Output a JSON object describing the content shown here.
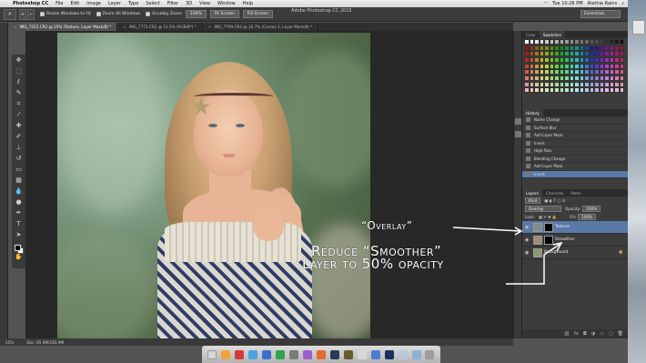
{
  "menubar": {
    "app_name": "Photoshop CC",
    "items": [
      "File",
      "Edit",
      "Image",
      "Layer",
      "Type",
      "Select",
      "Filter",
      "3D",
      "View",
      "Window",
      "Help"
    ],
    "clock": "Tue 10:26 PM",
    "user": "Alethia Rains"
  },
  "options_bar": {
    "checks": [
      "Resize Windows to Fit",
      "Zoom All Windows",
      "Scrubby Zoom"
    ],
    "buttons": [
      "100%",
      "Fit Screen",
      "Fill Screen"
    ],
    "window_title": "Adobe Photoshop CC 2015",
    "workspace": "Essentials"
  },
  "doc_tabs": [
    {
      "label": "IMG_7222.CR2 @ 25% (Texture, Layer Mask/8) *",
      "active": true
    },
    {
      "label": "IMG_7773.CR2 @ 12.5% (RGB/8*) *",
      "active": false
    },
    {
      "label": "IMG_7799.CR2 @ 16.7% (Curves 1, Layer Mask/8) *",
      "active": false
    }
  ],
  "status_bar": {
    "zoom": "25%",
    "doc": "Doc: 85.9M/185.9M"
  },
  "panels": {
    "tabs": [
      "Color",
      "Swatches"
    ],
    "history_title": "History",
    "history_items": [
      "Name Change",
      "Surface Blur",
      "Add Layer Mask",
      "Invert",
      "High Pass",
      "Blending Change",
      "Add Layer Mask",
      "Invert"
    ],
    "layers_tabs": [
      "Layers",
      "Channels",
      "Paths"
    ],
    "kind": "Kind",
    "blend_mode": "Overlay",
    "opacity_label": "Opacity:",
    "opacity_value": "100%",
    "lock_label": "Lock:",
    "fill_label": "Fill:",
    "fill_value": "100%",
    "layers": [
      {
        "name": "Texture",
        "selected": true
      },
      {
        "name": "Smoother",
        "selected": false
      },
      {
        "name": "Background",
        "selected": false
      }
    ]
  },
  "annotations": {
    "overlay": "“Overlay”",
    "line1": "Reduce “Smoother”",
    "line2": "Layer to 50% opacity"
  },
  "colors": {
    "selection": "#5a79a8",
    "panel": "#3c3c3c"
  }
}
